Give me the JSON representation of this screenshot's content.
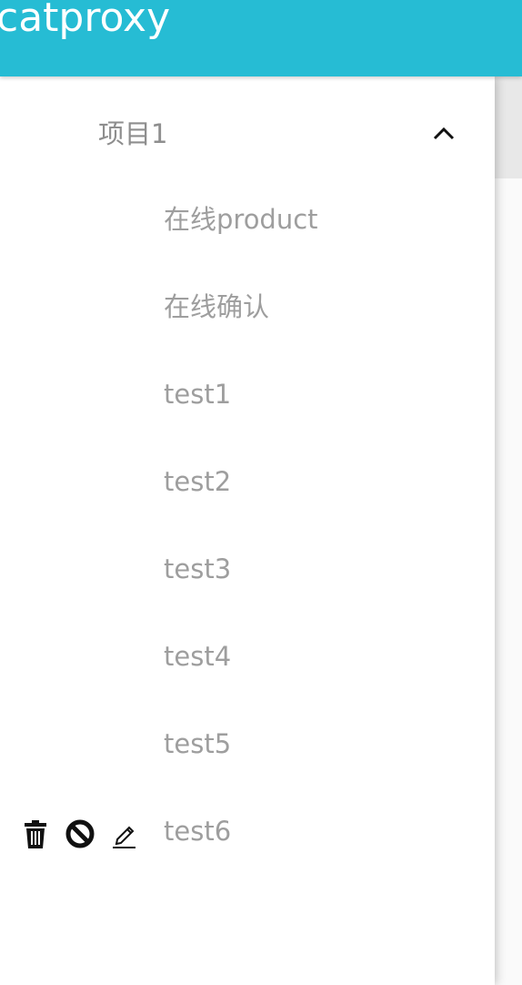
{
  "app": {
    "title": "catproxy",
    "accent_color": "#26bcd4"
  },
  "sidebar": {
    "group": {
      "label": "项目1",
      "icon": "chevron-up-icon",
      "expanded": true
    },
    "items": [
      {
        "label": "在线product"
      },
      {
        "label": "在线确认"
      },
      {
        "label": "test1"
      },
      {
        "label": "test2"
      },
      {
        "label": "test3"
      },
      {
        "label": "test4"
      },
      {
        "label": "test5"
      },
      {
        "label": "test6"
      }
    ],
    "row_actions": [
      {
        "icon": "trash-icon"
      },
      {
        "icon": "block-icon"
      },
      {
        "icon": "edit-icon"
      }
    ]
  }
}
